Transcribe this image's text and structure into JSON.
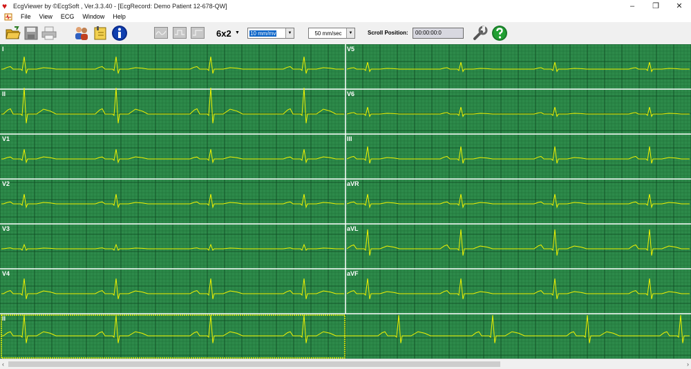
{
  "window": {
    "title": "EcgViewer by ©EcgSoft , Ver.3.3.40 - [EcgRecord: Demo Patient 12-678-QW]",
    "minimize_glyph": "–",
    "restore_glyph": "❐",
    "close_glyph": "✕",
    "mdi_minimize_glyph": "–",
    "mdi_restore_glyph": "❐",
    "mdi_close_glyph": "✕",
    "app_icon": "heart-icon"
  },
  "menu": [
    {
      "label": "File"
    },
    {
      "label": "View"
    },
    {
      "label": "ECG"
    },
    {
      "label": "Window"
    },
    {
      "label": "Help"
    }
  ],
  "toolbar": {
    "icons": [
      "open-folder-icon",
      "save-icon",
      "print-icon",
      "patients-icon",
      "record-book-icon",
      "info-icon"
    ],
    "waveform_buttons": [
      "waveform-smooth-icon",
      "waveform-square-icon",
      "waveform-step-icon"
    ],
    "layout": "6x2",
    "amplitude": "10 mm/mv",
    "speed": "50 mm/sec",
    "scroll_position_label": "Scroll Position:",
    "scroll_position": "00:00:00:0",
    "right_icons": [
      "settings-wrench-icon",
      "help-icon"
    ]
  },
  "ecg": {
    "colors": {
      "background": "#2d8a4a",
      "grid_minor": "#1f6e37",
      "grid_major": "#0f4a22",
      "trace": "#f3f300",
      "separator": "#ffffff",
      "selection": "#f3f300"
    },
    "left_leads": [
      "I",
      "II",
      "V1",
      "V2",
      "V3",
      "V4"
    ],
    "right_leads": [
      "V5",
      "V6",
      "III",
      "aVR",
      "aVL",
      "aVF"
    ],
    "rhythm_lead": "II",
    "selected_panel": "rhythm-II"
  }
}
